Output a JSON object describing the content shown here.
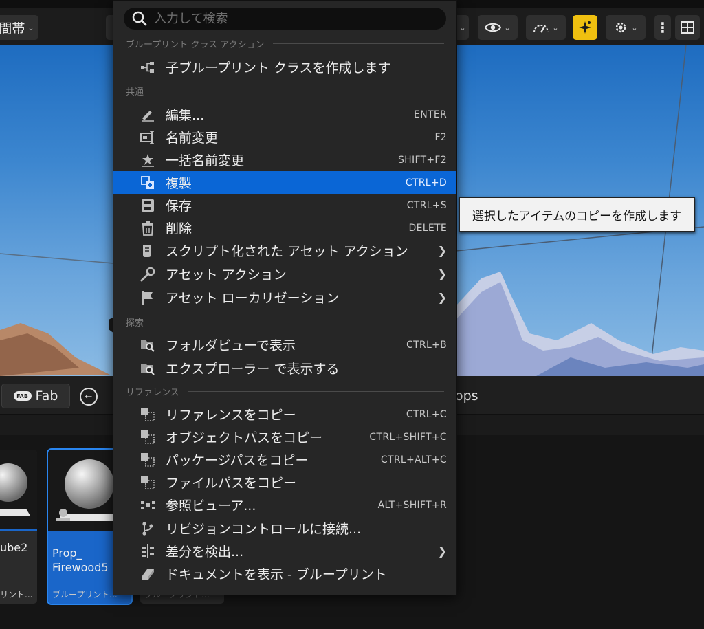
{
  "toolbar": {
    "left_label": "間帯",
    "buttons": [
      {
        "name": "eye-icon"
      },
      {
        "name": "gauge-icon"
      },
      {
        "name": "sparkle-icon",
        "accent": "#f0c010"
      },
      {
        "name": "gear-icon"
      },
      {
        "name": "more-vertical-icon"
      },
      {
        "name": "layout-grid-icon"
      }
    ]
  },
  "content_browser": {
    "fab_label": "Fab",
    "path_fragment": "ops",
    "assets": [
      {
        "name": "ube2",
        "type": "リント..."
      },
      {
        "name": "Prop_\nFirewood5",
        "type": "ブループリント...",
        "selected": true
      },
      {
        "name": "",
        "type": "ブループリント..."
      }
    ]
  },
  "menu": {
    "search_placeholder": "入力して検索",
    "sections": {
      "class_actions": "ブループリント クラス アクション",
      "common": "共通",
      "explore": "探索",
      "references": "リファレンス"
    },
    "items": {
      "create_child": {
        "label": "子ブループリント クラスを作成します",
        "icon": "child-class-icon"
      },
      "edit": {
        "label": "編集...",
        "shortcut": "ENTER",
        "icon": "pencil-icon"
      },
      "rename": {
        "label": "名前変更",
        "shortcut": "F2",
        "icon": "rename-icon"
      },
      "bulk_rename": {
        "label": "一括名前変更",
        "shortcut": "SHIFT+F2",
        "icon": "bulk-rename-icon"
      },
      "duplicate": {
        "label": "複製",
        "shortcut": "CTRL+D",
        "icon": "duplicate-icon"
      },
      "save": {
        "label": "保存",
        "shortcut": "CTRL+S",
        "icon": "save-icon"
      },
      "delete": {
        "label": "削除",
        "shortcut": "DELETE",
        "icon": "trash-icon"
      },
      "scripted_actions": {
        "label": "スクリプト化された アセット アクション",
        "icon": "script-icon"
      },
      "asset_actions": {
        "label": "アセット アクション",
        "icon": "wrench-icon"
      },
      "asset_localization": {
        "label": "アセット ローカリゼーション",
        "icon": "flag-icon"
      },
      "show_in_folder": {
        "label": "フォルダビューで表示",
        "shortcut": "CTRL+B",
        "icon": "folder-search-icon"
      },
      "show_in_explorer": {
        "label": "エクスプローラー で表示する",
        "icon": "folder-search-icon"
      },
      "copy_reference": {
        "label": "リファレンスをコピー",
        "shortcut": "CTRL+C",
        "icon": "copy-icon"
      },
      "copy_object_path": {
        "label": "オブジェクトパスをコピー",
        "shortcut": "CTRL+SHIFT+C",
        "icon": "copy-icon"
      },
      "copy_package_path": {
        "label": "パッケージパスをコピー",
        "shortcut": "CTRL+ALT+C",
        "icon": "copy-icon"
      },
      "copy_file_path": {
        "label": "ファイルパスをコピー",
        "icon": "copy-icon"
      },
      "reference_viewer": {
        "label": "参照ビューア...",
        "shortcut": "ALT+SHIFT+R",
        "icon": "reference-viewer-icon"
      },
      "source_control": {
        "label": "リビジョンコントロールに接続...",
        "icon": "branch-icon"
      },
      "diff": {
        "label": "差分を検出...",
        "icon": "diff-icon"
      },
      "view_docs": {
        "label": "ドキュメントを表示 - ブループリント",
        "icon": "eraser-docs-icon"
      }
    }
  },
  "tooltip": {
    "text": "選択したアイテムのコピーを作成します"
  },
  "colors": {
    "highlight": "#0a66d6",
    "menu_bg": "#262626",
    "accent_yellow": "#f0c010"
  }
}
